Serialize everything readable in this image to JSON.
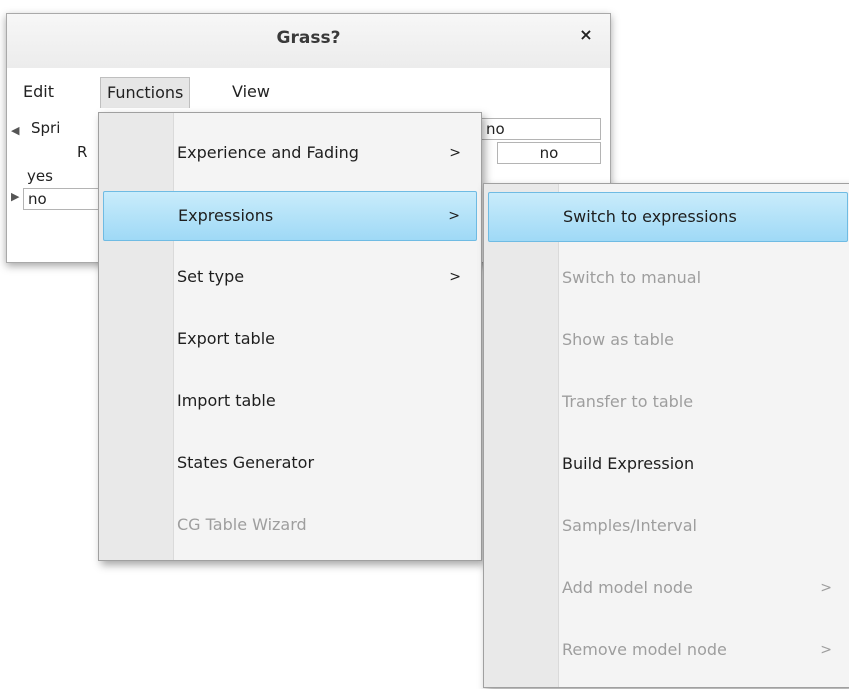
{
  "window": {
    "title": "Grass?",
    "close_glyph": "×"
  },
  "menubar": {
    "items": [
      "Edit",
      "Functions",
      "View"
    ]
  },
  "table": {
    "header1": {
      "label": "Spri",
      "yes": "",
      "no": "no"
    },
    "header2": {
      "label": "R",
      "no": "no"
    },
    "rows": [
      "yes",
      "no"
    ]
  },
  "functions_menu": {
    "items": [
      {
        "label": "Experience and Fading",
        "submenu": ">",
        "state": "normal"
      },
      {
        "label": "Expressions",
        "submenu": ">",
        "state": "highlighted"
      },
      {
        "label": "Set type",
        "submenu": ">",
        "state": "normal"
      },
      {
        "label": "Export table",
        "submenu": "",
        "state": "normal"
      },
      {
        "label": "Import table",
        "submenu": "",
        "state": "normal"
      },
      {
        "label": "States Generator",
        "submenu": "",
        "state": "normal"
      },
      {
        "label": "CG Table Wizard",
        "submenu": "",
        "state": "disabled"
      }
    ]
  },
  "expressions_menu": {
    "items": [
      {
        "label": "Switch to expressions",
        "submenu": "",
        "state": "highlighted"
      },
      {
        "label": "Switch to manual",
        "submenu": "",
        "state": "disabled"
      },
      {
        "label": "Show as table",
        "submenu": "",
        "state": "disabled"
      },
      {
        "label": "Transfer to table",
        "submenu": "",
        "state": "disabled"
      },
      {
        "label": "Build Expression",
        "submenu": "",
        "state": "normal"
      },
      {
        "label": "Samples/Interval",
        "submenu": "",
        "state": "disabled"
      },
      {
        "label": "Add model node",
        "submenu": ">",
        "state": "disabled"
      },
      {
        "label": "Remove model node",
        "submenu": ">",
        "state": "disabled"
      }
    ]
  },
  "colors": {
    "highlight": "#a8dcf7",
    "disabled_text": "#9e9e9e",
    "accent_border": "#6fbbe3"
  }
}
